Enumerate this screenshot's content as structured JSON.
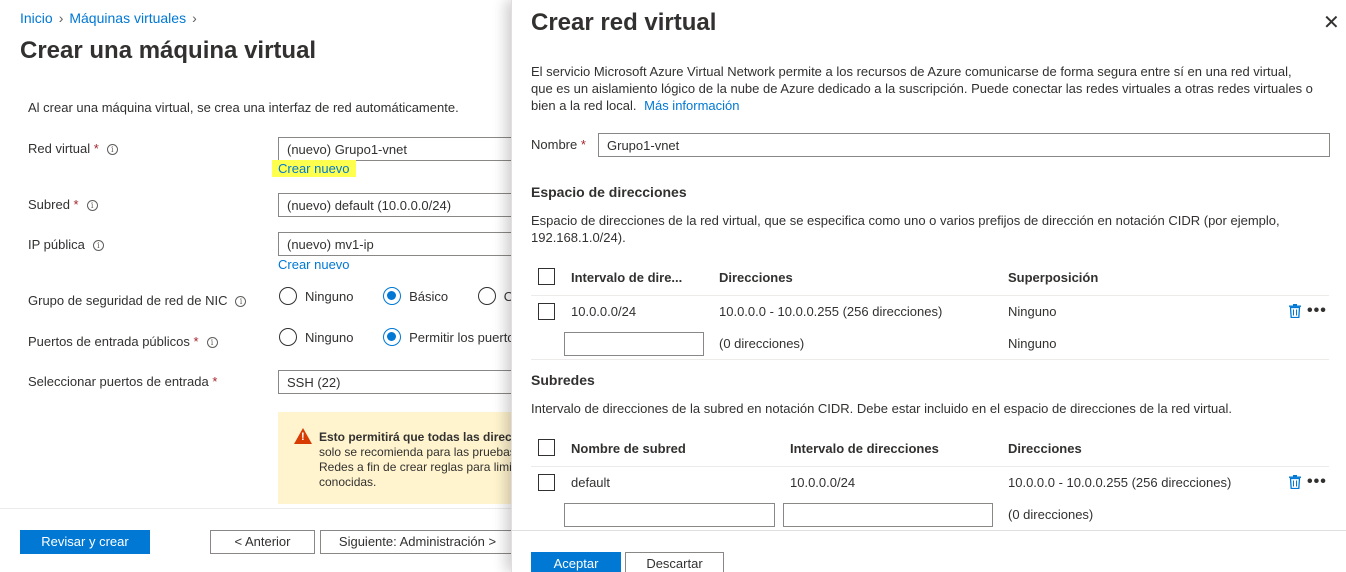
{
  "breadcrumb": {
    "home": "Inicio",
    "parent": "Máquinas virtuales"
  },
  "page": {
    "title": "Crear una máquina virtual",
    "intro": "Al crear una máquina virtual, se crea una interfaz de red automáticamente."
  },
  "form": {
    "vnet": {
      "label": "Red virtual",
      "value": "(nuevo) Grupo1-vnet",
      "create_link": "Crear nuevo"
    },
    "subnet": {
      "label": "Subred",
      "value": "(nuevo) default (10.0.0.0/24)"
    },
    "public_ip": {
      "label": "IP pública",
      "value": "(nuevo) mv1-ip",
      "create_link": "Crear nuevo"
    },
    "nsg": {
      "label": "Grupo de seguridad de red de NIC",
      "options": [
        "Ninguno",
        "Básico",
        "Opcion"
      ],
      "selected": "Básico"
    },
    "public_ports": {
      "label": "Puertos de entrada públicos",
      "options": [
        "Ninguno",
        "Permitir los puertos"
      ],
      "selected": "Permitir los puertos"
    },
    "select_ports": {
      "label": "Seleccionar puertos de entrada",
      "value": "SSH (22)"
    },
    "required_mark": "*",
    "warning": {
      "bold": "Esto permitirá que todas las direcci",
      "line2": "solo se recomienda para las pruebas.",
      "line3": "Redes a fin de crear reglas para limita",
      "line4": "conocidas."
    }
  },
  "footer": {
    "review": "Revisar y crear",
    "prev": "< Anterior",
    "next": "Siguiente: Administración >"
  },
  "panel": {
    "title": "Crear red virtual",
    "close_glyph": "✕",
    "desc_line1": "El servicio Microsoft Azure Virtual Network permite a los recursos de Azure comunicarse de forma segura entre sí en una red virtual,",
    "desc_line2": "que es un aislamiento lógico de la nube de Azure dedicado a la suscripción. Puede conectar las redes virtuales a otras redes virtuales o",
    "desc_line3": "bien a la red local.",
    "more_info": "Más información",
    "name_label": "Nombre",
    "name_value": "Grupo1-vnet",
    "address_space": {
      "title": "Espacio de direcciones",
      "desc_line1": "Espacio de direcciones de la red virtual, que se especifica como uno o varios prefijos de dirección en notación CIDR (por ejemplo,",
      "desc_line2": "192.168.1.0/24).",
      "headers": [
        "Intervalo de dire...",
        "Direcciones",
        "Superposición"
      ],
      "row": {
        "range": "10.0.0.0/24",
        "addresses": "10.0.0.0 - 10.0.0.255 (256 direcciones)",
        "overlap": "Ninguno"
      },
      "new_row": {
        "addresses": "(0 direcciones)",
        "overlap": "Ninguno"
      }
    },
    "subnets": {
      "title": "Subredes",
      "desc": "Intervalo de direcciones de la subred en notación CIDR. Debe estar incluido en el espacio de direcciones de la red virtual.",
      "headers": [
        "Nombre de subred",
        "Intervalo de direcciones",
        "Direcciones"
      ],
      "row": {
        "name": "default",
        "range": "10.0.0.0/24",
        "addresses": "10.0.0.0 - 10.0.0.255 (256 direcciones)"
      },
      "new_row": {
        "addresses": "(0 direcciones)"
      }
    },
    "ok": "Aceptar",
    "discard": "Descartar"
  },
  "colors": {
    "accent": "#0078d4",
    "warning_bg": "#fff4ce",
    "highlight": "#ffff4d"
  }
}
